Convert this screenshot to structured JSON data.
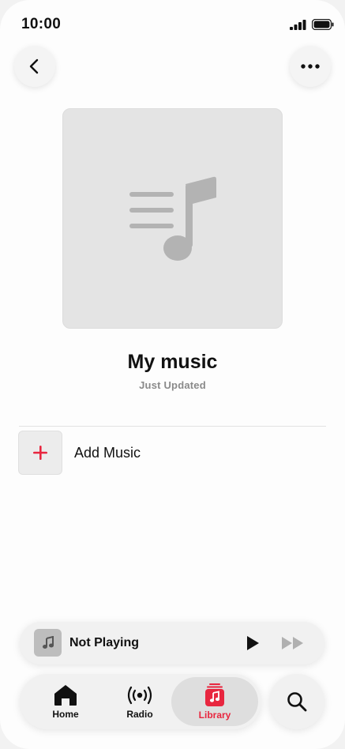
{
  "status_bar": {
    "time": "10:00"
  },
  "header": {
    "back_icon": "chevron-left-icon",
    "more_icon": "ellipsis-icon"
  },
  "playlist": {
    "title": "My music",
    "subtitle": "Just Updated",
    "artwork_icon": "music-list-icon"
  },
  "actions": {
    "add_music_label": "Add Music",
    "add_icon": "plus-icon"
  },
  "mini_player": {
    "title": "Not Playing",
    "play_icon": "play-icon",
    "next_icon": "fast-forward-icon"
  },
  "tab_bar": {
    "tabs": [
      {
        "label": "Home",
        "icon": "home-icon"
      },
      {
        "label": "Radio",
        "icon": "radio-broadcast-icon"
      },
      {
        "label": "Library",
        "icon": "library-icon",
        "selected": true
      }
    ],
    "search_icon": "magnifying-glass-icon"
  },
  "colors": {
    "accent": "#e8263f",
    "background": "#fdfdfd",
    "artwork_bg": "#e4e4e4"
  }
}
